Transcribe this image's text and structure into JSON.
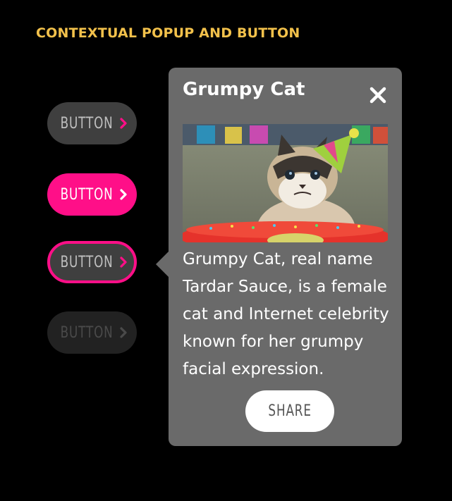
{
  "section_title": "CONTEXTUAL POPUP AND BUTTON",
  "buttons": [
    {
      "label": "BUTTON",
      "state": "default"
    },
    {
      "label": "BUTTON",
      "state": "hover"
    },
    {
      "label": "BUTTON",
      "state": "focus"
    },
    {
      "label": "BUTTON",
      "state": "disabled"
    }
  ],
  "popup": {
    "title": "Grumpy Cat",
    "close_icon": "close-icon",
    "image": "grumpy-cat-birthday-photo",
    "description": "Grumpy Cat, real name Tardar Sauce, is a female cat and Internet celebrity known for her grumpy facial expression.",
    "share_label": "SHARE"
  },
  "colors": {
    "accent": "#ff0f88",
    "title": "#f2c14b",
    "popup_bg": "#6a6a6a",
    "button_bg": "#3f3f3f",
    "button_disabled_bg": "#222222"
  }
}
